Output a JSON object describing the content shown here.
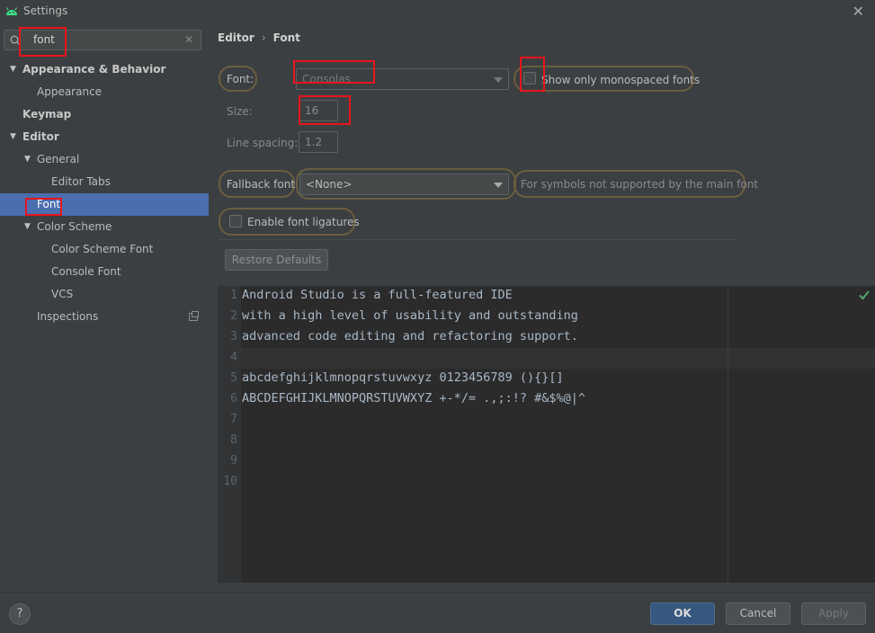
{
  "window": {
    "title": "Settings"
  },
  "search": {
    "value": "font",
    "clear_glyph": "✕"
  },
  "tree": [
    {
      "label": "Appearance & Behavior",
      "level": 0,
      "expanded": true,
      "bold": true
    },
    {
      "label": "Appearance",
      "level": 1
    },
    {
      "label": "Keymap",
      "level": 0,
      "bold": true
    },
    {
      "label": "Editor",
      "level": 0,
      "expanded": true,
      "bold": true
    },
    {
      "label": "General",
      "level": 1,
      "expanded": true
    },
    {
      "label": "Editor Tabs",
      "level": 2
    },
    {
      "label": "Font",
      "level": 1,
      "selected": true
    },
    {
      "label": "Color Scheme",
      "level": 1,
      "expanded": true
    },
    {
      "label": "Color Scheme Font",
      "level": 2
    },
    {
      "label": "Console Font",
      "level": 2
    },
    {
      "label": "VCS",
      "level": 2
    },
    {
      "label": "Inspections",
      "level": 1
    }
  ],
  "breadcrumb": {
    "parent": "Editor",
    "separator": "›",
    "current": "Font"
  },
  "font": {
    "font_label": "Font:",
    "font_value": "Consolas",
    "monospaced_label": "Show only monospaced fonts",
    "monospaced_checked": false,
    "size_label": "Size:",
    "size_value": "16",
    "spacing_label": "Line spacing:",
    "spacing_value": "1.2",
    "fallback_label": "Fallback font:",
    "fallback_value": "<None>",
    "fallback_hint": "For symbols not supported by the main font",
    "ligatures_label": "Enable font ligatures",
    "ligatures_checked": false,
    "restore_label": "Restore Defaults"
  },
  "preview": {
    "line_numbers": [
      "1",
      "2",
      "3",
      "4",
      "5",
      "6",
      "7",
      "8",
      "9",
      "10"
    ],
    "lines": [
      "Android Studio is a full-featured IDE",
      "with a high level of usability and outstanding",
      "advanced code editing and refactoring support.",
      "",
      "abcdefghijklmnopqrstuvwxyz 0123456789 (){}[]",
      "ABCDEFGHIJKLMNOPQRSTUVWXYZ +-*/= .,;:!? #&$%@|^"
    ]
  },
  "footer": {
    "help": "?",
    "ok": "OK",
    "cancel": "Cancel",
    "apply": "Apply"
  },
  "colors": {
    "background": "#3c3f41",
    "selection": "#4b6eaf",
    "editor_bg": "#2b2b2b",
    "annotation": "#e8141c",
    "focus_outline": "#6b5d3e"
  }
}
